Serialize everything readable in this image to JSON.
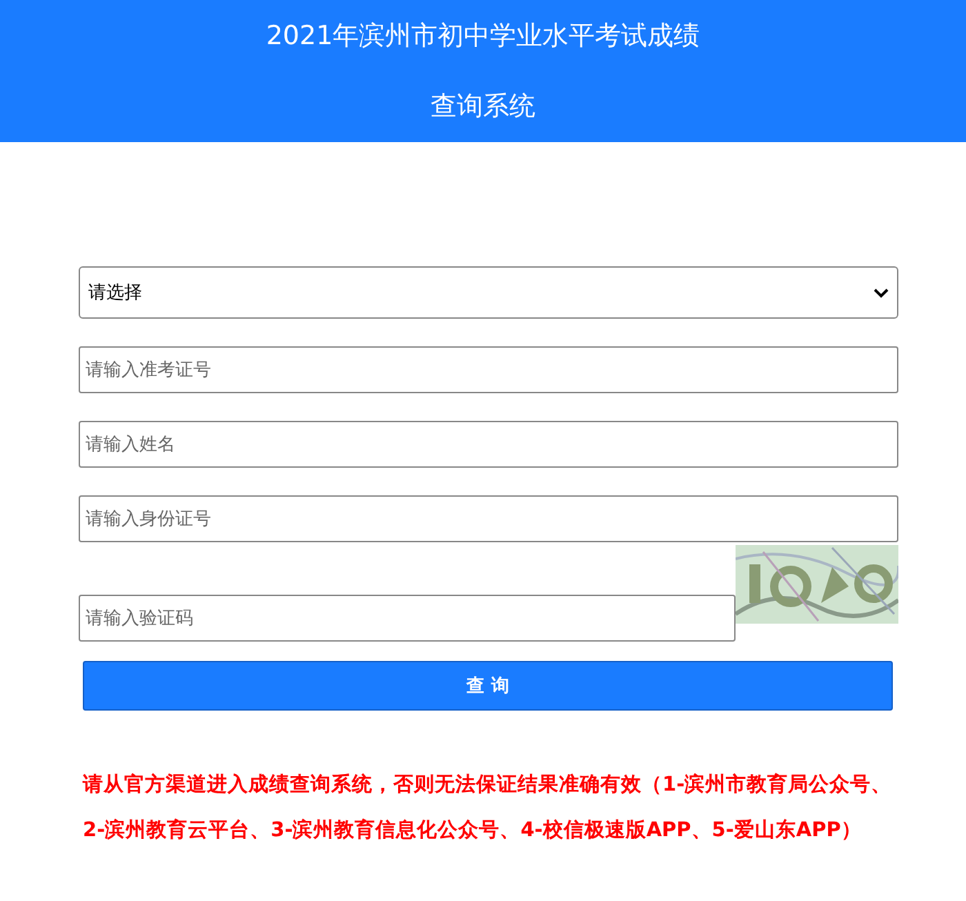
{
  "header": {
    "title_lines": [
      "2021年滨州市初中学业水平考试成绩",
      "查询系统"
    ]
  },
  "form": {
    "fields": [
      {
        "kind": "select",
        "value": "请选择"
      },
      {
        "kind": "input",
        "placeholder": "请输入准考证号"
      },
      {
        "kind": "input",
        "placeholder": "请输入姓名"
      },
      {
        "kind": "input",
        "placeholder": "请输入身份证号"
      },
      {
        "kind": "captcha",
        "placeholder": "请输入验证码"
      }
    ],
    "submit": "查 询"
  },
  "notice": "请从官方渠道进入成绩查询系统，否则无法保证结果准确有效（1-滨州市教育局公众号、2-滨州教育云平台、3-滨州教育信息化公众号、4-校信极速版APP、5-爱山东APP）"
}
